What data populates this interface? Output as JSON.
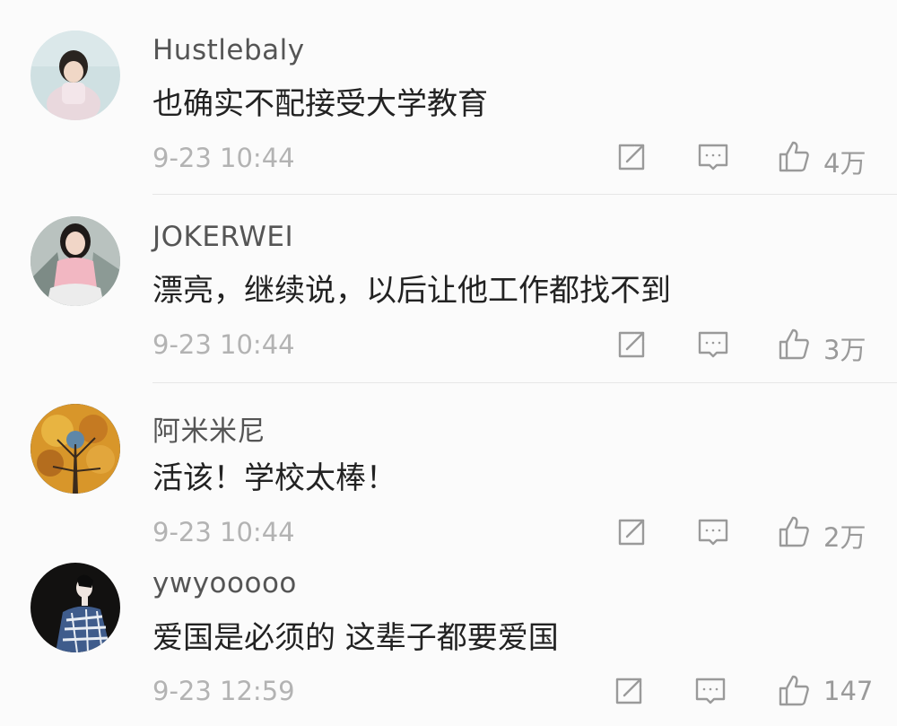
{
  "comments": [
    {
      "username": "Hustlebaly",
      "text": "也确实不配接受大学教育",
      "time": "9-23 10:44",
      "likes": "4万",
      "avatar_icon": "child-avatar"
    },
    {
      "username": "JOKERWEI",
      "text": "漂亮，继续说，以后让他工作都找不到",
      "time": "9-23 10:44",
      "likes": "3万",
      "avatar_icon": "girl-avatar"
    },
    {
      "username": "阿米米尼",
      "text": "活该！学校太棒！",
      "time": "9-23 10:44",
      "likes": "2万",
      "avatar_icon": "autumn-tree-avatar"
    },
    {
      "username": "ywyooooo",
      "text": "爱国是必须的 这辈子都要爱国",
      "time": "9-23 12:59",
      "likes": "147",
      "avatar_icon": "kimono-avatar"
    }
  ],
  "icons": {
    "share": "share-icon",
    "reply": "reply-icon",
    "like": "thumbs-up-icon"
  },
  "colors": {
    "background": "#fbfbfb",
    "username": "#555555",
    "text": "#222222",
    "meta": "#b3b3b3",
    "icon": "#9a9a9a"
  }
}
